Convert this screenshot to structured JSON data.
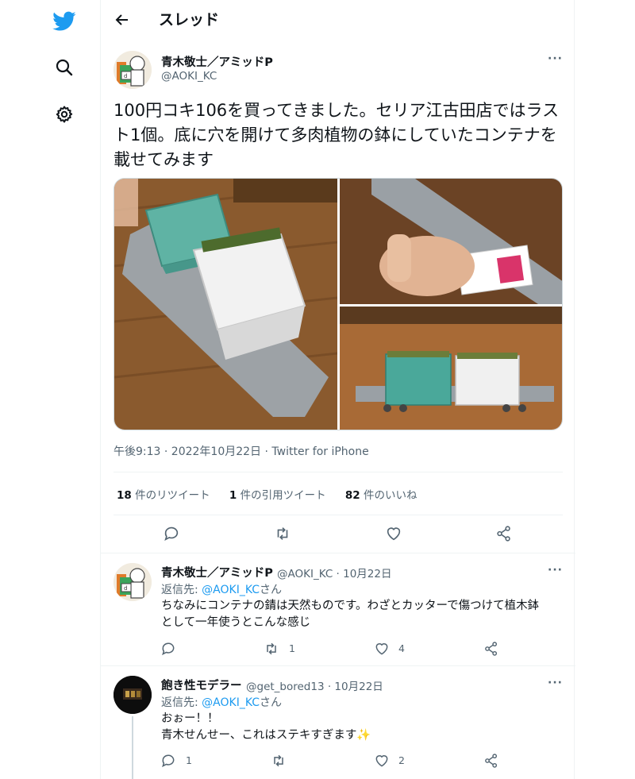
{
  "nav": {
    "icons": [
      "twitter-logo-icon",
      "search-icon",
      "gear-icon"
    ],
    "brand_color": "#1d9bf0"
  },
  "header": {
    "title": "スレッド"
  },
  "tweet": {
    "author": {
      "name": "青木敬士／アミッドP",
      "handle": "@AOKI_KC"
    },
    "text": "100円コキ106を買ってきました。セリア江古田店ではラスト1個。底に穴を開けて多肉植物の鉢にしていたコンテナを載せてみます",
    "timestamp": "午後9:13 · 2022年10月22日 · Twitter for iPhone",
    "stats": {
      "retweets": "18",
      "retweets_label": "件のリツイート",
      "quotes": "1",
      "quotes_label": "件の引用ツイート",
      "likes": "82",
      "likes_label": "件のいいね"
    }
  },
  "replies": [
    {
      "name": "青木敬士／アミッドP",
      "meta": "@AOKI_KC · 10月22日",
      "replying_prefix": "返信先: ",
      "replying_handle": "@AOKI_KC",
      "replying_suffix": "さん",
      "text_line1": "ちなみにコンテナの錆は天然ものです。わざとカッターで傷つけて植木鉢",
      "text_line2": "として一年使うとこんな感じ",
      "reply_count": "",
      "retweet_count": "1",
      "like_count": "4"
    },
    {
      "name": "飽き性モデラー",
      "meta": "@get_bored13 · 10月22日",
      "replying_prefix": "返信先: ",
      "replying_handle": "@AOKI_KC",
      "replying_suffix": "さん",
      "text_line1": "おぉー！！",
      "text_line2": "青木せんせー、これはステキすぎます✨",
      "reply_count": "1",
      "retweet_count": "",
      "like_count": "2"
    }
  ]
}
